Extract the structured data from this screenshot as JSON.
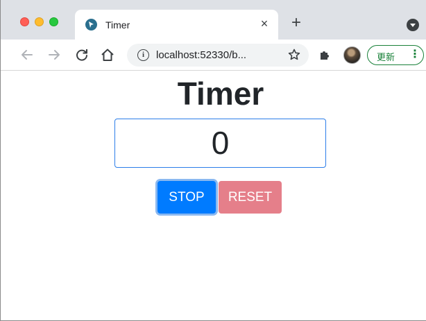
{
  "browser": {
    "tab": {
      "title": "Timer",
      "close_label": "×",
      "favicon_icon": "cursor-arrow-icon"
    },
    "new_tab_label": "+",
    "address": {
      "info_icon_label": "i",
      "url": "localhost:52330/b..."
    },
    "update_button": {
      "label": "更新",
      "more_label": "⋮",
      "color": "#188038"
    },
    "icons": {
      "back": "back-arrow-icon",
      "forward": "forward-arrow-icon",
      "reload": "reload-icon",
      "home": "home-icon",
      "star": "star-icon",
      "extensions": "puzzle-icon",
      "profile": "avatar"
    }
  },
  "page": {
    "title": "Timer",
    "timer_value": "0",
    "buttons": {
      "stop_label": "STOP",
      "reset_label": "RESET"
    },
    "colors": {
      "stop": "#007bff",
      "reset": "#e57f8a",
      "display_border": "#2b7de9"
    }
  }
}
